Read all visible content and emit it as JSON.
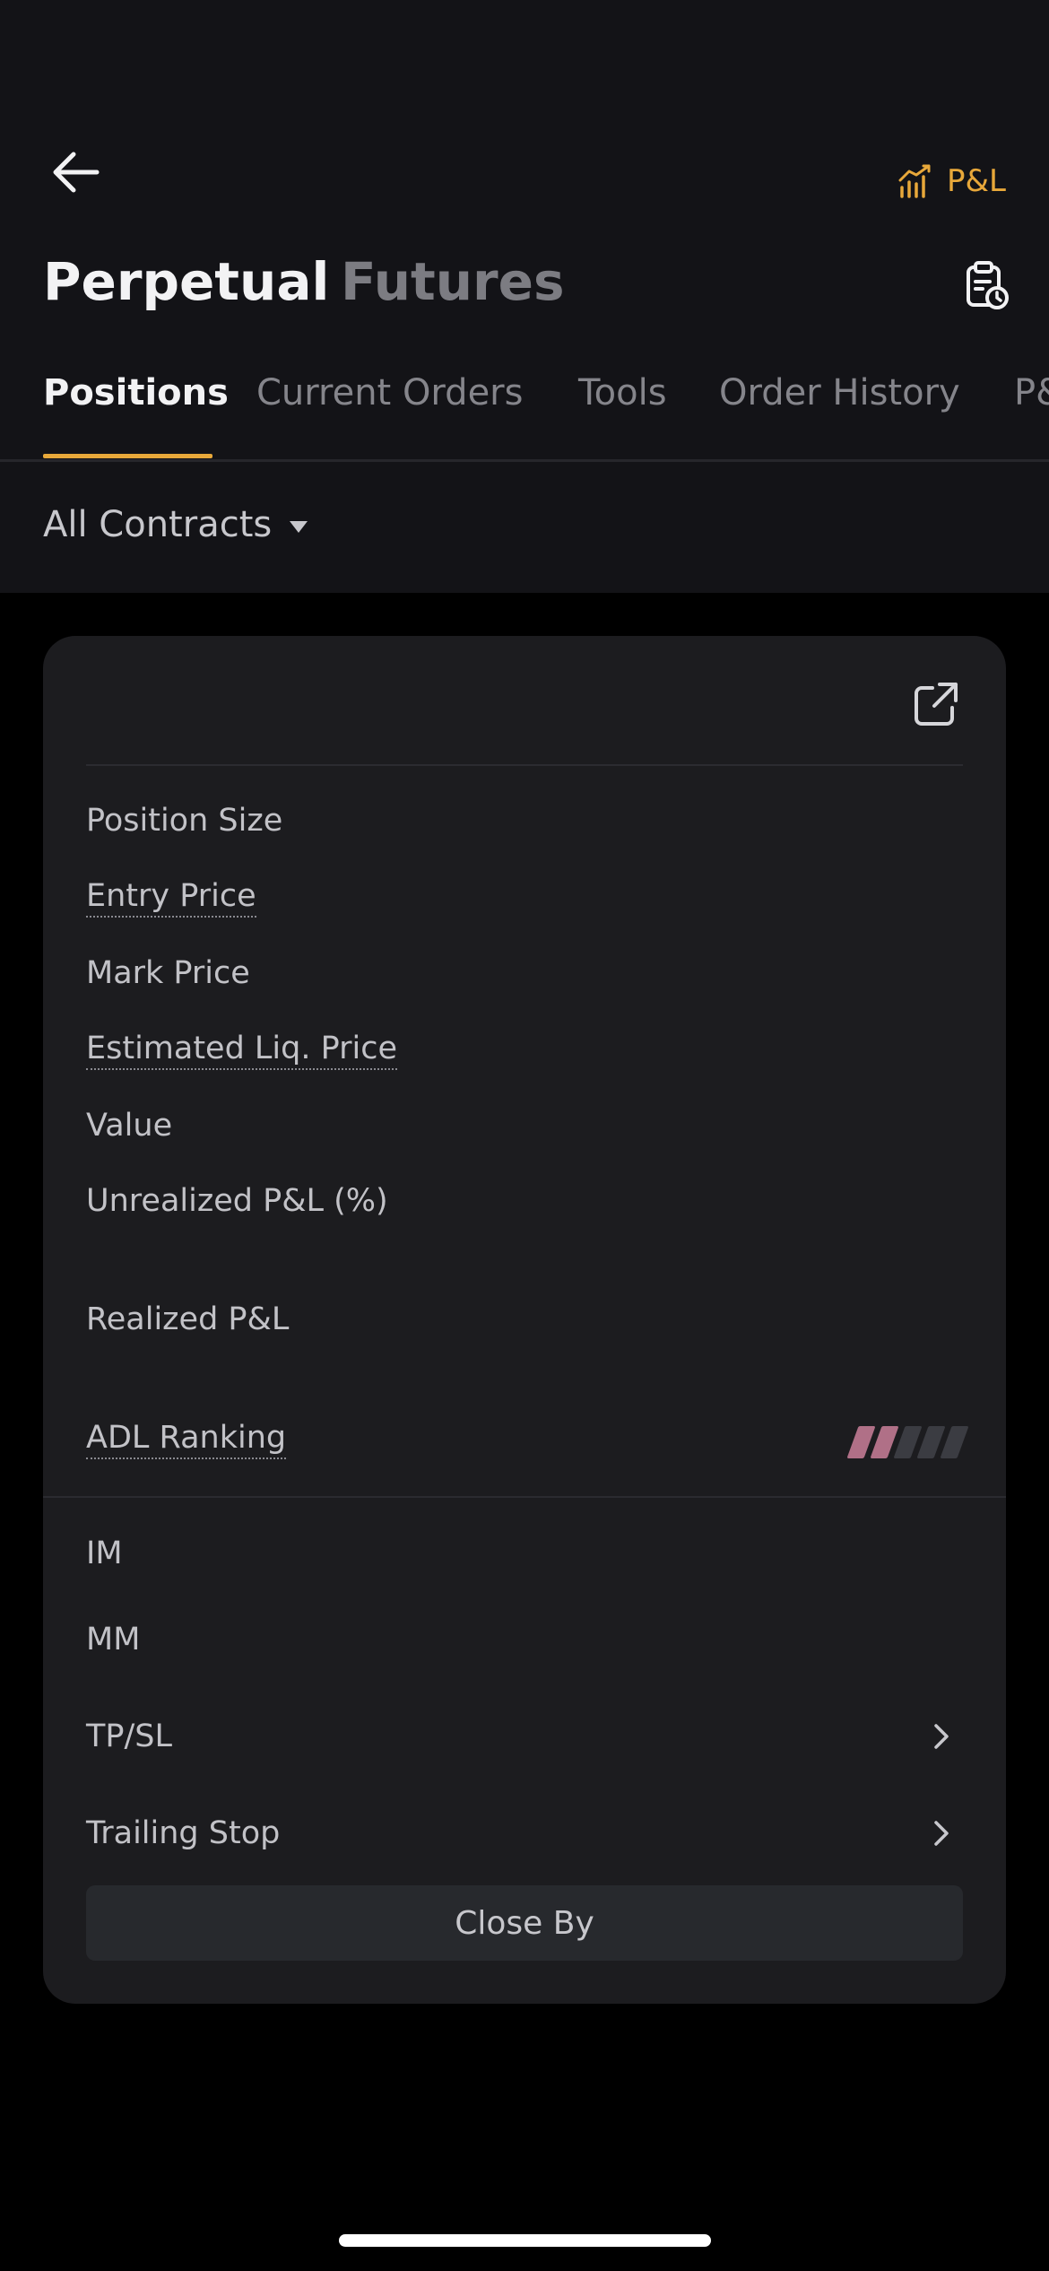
{
  "header": {
    "back_icon": "arrow-left-icon",
    "pnl_label": "P&L",
    "pnl_icon": "bar-chart-trend-icon",
    "history_icon": "clipboard-clock-icon"
  },
  "modes": {
    "perpetual": "Perpetual",
    "futures": "Futures",
    "active": "Perpetual"
  },
  "subtabs": {
    "items": [
      "Positions",
      "Current Orders",
      "Tools",
      "Order History",
      "P&L"
    ],
    "active": "Positions"
  },
  "filter": {
    "label": "All Contracts",
    "icon": "caret-down-icon"
  },
  "position_card": {
    "share_icon": "external-link-icon",
    "labels": {
      "position_size": "Position Size",
      "entry_price": "Entry Price",
      "mark_price": "Mark Price",
      "est_liq_price": "Estimated Liq. Price",
      "value": "Value",
      "unrealized_pnl": "Unrealized P&L (%)",
      "realized_pnl": "Realized P&L",
      "adl_ranking": "ADL Ranking",
      "im": "IM",
      "mm": "MM",
      "tpsl": "TP/SL",
      "trailing_stop": "Trailing Stop"
    },
    "adl_level": 2,
    "adl_max": 5,
    "close_button": "Close By"
  },
  "colors": {
    "accent": "#e8a83a",
    "adl_active": "#b07087",
    "adl_inactive": "#3b3c42",
    "card_bg": "#1c1c1f",
    "header_bg": "#131317"
  }
}
